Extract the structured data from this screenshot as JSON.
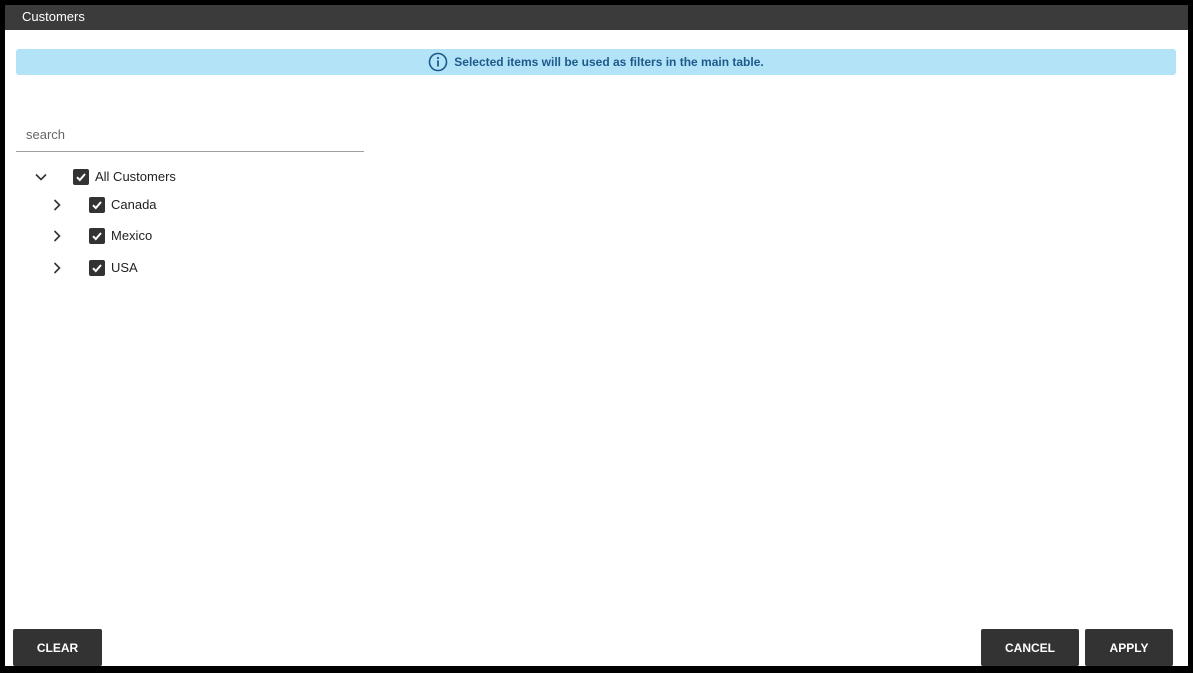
{
  "dialog": {
    "title": "Customers"
  },
  "banner": {
    "icon": "info-icon",
    "text": "Selected items will be used as filters in the main table."
  },
  "search": {
    "placeholder": "search",
    "value": ""
  },
  "tree": {
    "root": {
      "label": "All Customers",
      "checked": true,
      "expanded": true
    },
    "children": [
      {
        "label": "Canada",
        "checked": true,
        "expanded": false
      },
      {
        "label": "Mexico",
        "checked": true,
        "expanded": false
      },
      {
        "label": "USA",
        "checked": true,
        "expanded": false
      }
    ]
  },
  "buttons": {
    "clear": "CLEAR",
    "cancel": "CANCEL",
    "apply": "APPLY"
  },
  "colors": {
    "titlebar": "#3b3b3b",
    "banner_bg": "#b3e3f7",
    "banner_text": "#1d5a8c",
    "button_bg": "#333333",
    "checkbox": "#333333"
  }
}
